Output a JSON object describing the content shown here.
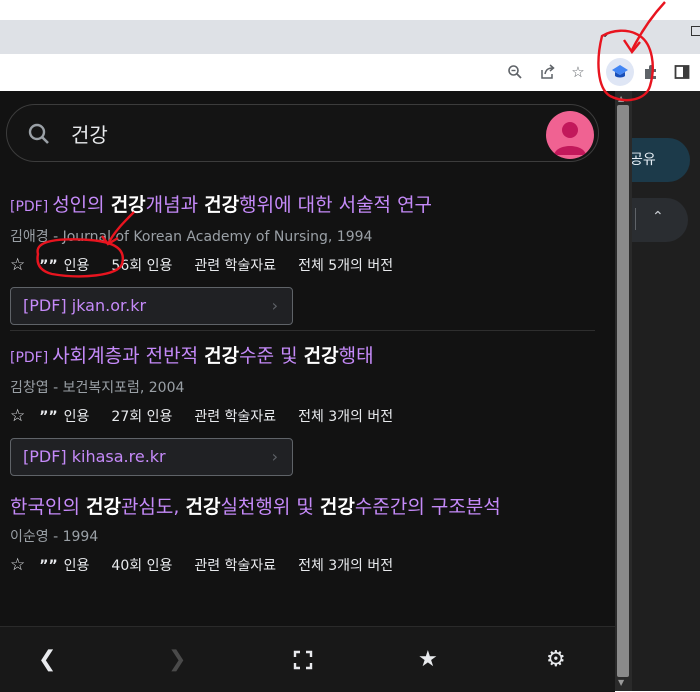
{
  "browser": {
    "share_label": "공유",
    "icons": [
      "chevron-down-icon",
      "zoom-icon",
      "share-icon",
      "bookmark-star-icon",
      "scholar-extension-icon",
      "puzzle-icon",
      "side-panel-icon"
    ]
  },
  "popup": {
    "search": {
      "query": "건강"
    },
    "results": [
      {
        "tag": "[PDF]",
        "title_parts": [
          {
            "text": "성인의 ",
            "bold": false
          },
          {
            "text": "건강",
            "bold": true
          },
          {
            "text": "개념과 ",
            "bold": false
          },
          {
            "text": "건강",
            "bold": true
          },
          {
            "text": "행위에 대한 서술적 연구",
            "bold": false
          }
        ],
        "author": "김애경 - Journal of Korean Academy of Nursing, 1994",
        "cite": "인용",
        "cited_by": "56회 인용",
        "related": "관련 학술자료",
        "versions": "전체 5개의 버전",
        "pdf_link": "[PDF] jkan.or.kr"
      },
      {
        "tag": "[PDF]",
        "title_parts": [
          {
            "text": "사회계층과 전반적 ",
            "bold": false
          },
          {
            "text": "건강",
            "bold": true
          },
          {
            "text": "수준 및 ",
            "bold": false
          },
          {
            "text": "건강",
            "bold": true
          },
          {
            "text": "행태",
            "bold": false
          }
        ],
        "author": "김창엽 - 보건복지포럼, 2004",
        "cite": "인용",
        "cited_by": "27회 인용",
        "related": "관련 학술자료",
        "versions": "전체 3개의 버전",
        "pdf_link": "[PDF] kihasa.re.kr"
      },
      {
        "tag": "",
        "title_parts": [
          {
            "text": "한국인의 ",
            "bold": false
          },
          {
            "text": "건강",
            "bold": true
          },
          {
            "text": "관심도, ",
            "bold": false
          },
          {
            "text": "건강",
            "bold": true
          },
          {
            "text": "실천행위 및 ",
            "bold": false
          },
          {
            "text": "건강",
            "bold": true
          },
          {
            "text": "수준간의 구조분석",
            "bold": false
          }
        ],
        "author": "이순영 - 1994",
        "cite": "인용",
        "cited_by": "40회 인용",
        "related": "관련 학술자료",
        "versions": "전체 3개의 버전",
        "pdf_link": ""
      }
    ],
    "footer_icons": [
      "back-icon",
      "forward-icon",
      "fullscreen-icon",
      "library-star-icon",
      "settings-gear-icon"
    ]
  },
  "colors": {
    "accent": "#c58af9",
    "background": "#121212",
    "annotation": "#e8141f"
  }
}
